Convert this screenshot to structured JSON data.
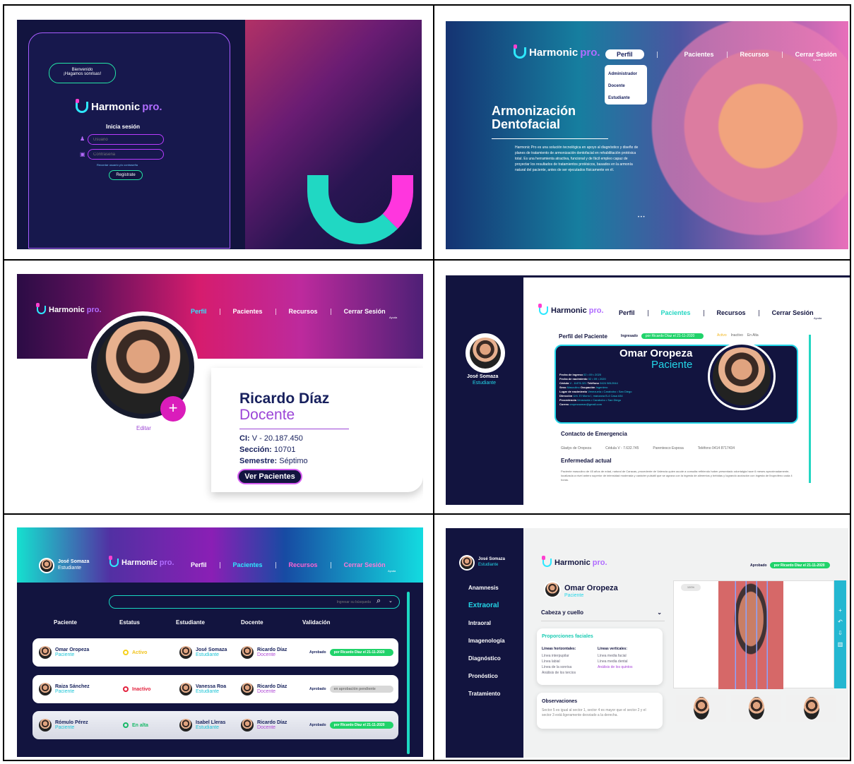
{
  "login": {
    "greeting_1": "Bienvenido",
    "greeting_2": "¡Hagamos sonrisas!",
    "brand": "Harmonic",
    "brand_pro": "pro.",
    "heading": "Inicia sesión",
    "user_placeholder": "Usuario",
    "password_placeholder": "Contraseña",
    "forgot": "Recordar usuario y/o contraseña",
    "register": "Registrate"
  },
  "home": {
    "brand": "Harmonic",
    "brand_pro": "pro.",
    "nav": [
      "Perfil",
      "Pacientes",
      "Recursos",
      "Cerrar Sesión"
    ],
    "help": "Ayuda",
    "dropdown": [
      "Administrador",
      "Docente",
      "Estudiante"
    ],
    "hero_title": "Armonización Dentofacial",
    "hero_body": "Harmonic Pro es una solución tecnológica en apoyo al diagnóstico y diseño de planes de tratamiento de armonización dentofacial en rehabilitación protésica total. Es una herramienta atractiva, funcional y de fácil empleo capaz de proyectar los resultados de tratamientos protésicos, basados en la armonía natural del paciente, antes de ser ejecutados físicamente en él.",
    "dots": "• • •"
  },
  "profile": {
    "brand": "Harmonic",
    "brand_pro": "pro.",
    "nav": [
      "Perfil",
      "Pacientes",
      "Recursos",
      "Cerrar Sesión"
    ],
    "help": "Ayuda",
    "edit": "Editar",
    "name": "Ricardo Díaz",
    "role": "Docente",
    "ci_label": "CI:",
    "ci": "V - 20.187.450",
    "section_label": "Sección:",
    "section": "10701",
    "semester_label": "Semestre:",
    "semester": "Séptimo",
    "button": "Ver Pacientes"
  },
  "patient": {
    "brand": "Harmonic",
    "brand_pro": "pro.",
    "nav": [
      "Perfil",
      "Pacientes",
      "Recursos",
      "Cerrar Sesión"
    ],
    "help": "Ayuda",
    "student_name": "José Somaza",
    "student_role": "Estudiante",
    "section_title": "Perfil del Paciente",
    "state_ingresado": "Ingresado",
    "approval_text": "por Ricardo Díaz el 21-11-2020",
    "state_active": "Activo",
    "state_inactive": "Inactivo",
    "state_discharged": "En Alta",
    "patient_name": "Omar Oropeza",
    "patient_role": "Paciente",
    "fields": [
      {
        "label": "Fecha de ingreso",
        "value": "02 • 09 • 2020"
      },
      {
        "label": "Fecha de nacimiento",
        "value": "02 • 09 • 2020"
      },
      {
        "label": "Cédula",
        "value": "V - 8.876.321"
      },
      {
        "label": "Teléfono",
        "value": "0424 9812044"
      },
      {
        "label": "Sexo",
        "value": "Masculino"
      },
      {
        "label": "Ocupación",
        "value": "Ingeniero"
      },
      {
        "label": "Lugar de nacimiento",
        "value": "Venezuela • Carabobo • San Diego"
      },
      {
        "label": "Dirección",
        "value": "Urb. El Morro I, manzana B-4 Casa #34"
      },
      {
        "label": "Procedencia",
        "value": "Venezuela • Carabobo • San Diego"
      },
      {
        "label": "Correo",
        "value": "oropezaomar@gmail.com"
      }
    ],
    "emergency_title": "Contacto de Emergencia",
    "emergency_name": "Gladys de Oropeza",
    "emergency_ci": "Cédula V - 7.632.745",
    "emergency_relation": "Parentesco Esposa",
    "emergency_phone": "Teléfono 0414 8717434",
    "illness_title": "Enfermedad actual",
    "illness_text": "Paciente masculino de 45 años de edad, natural de Caracas, procedente de Valencia quien acude a consulta refiriendo haber presentado odontalgia hace 6 meses aproximadamente, localizada a nivel antero superior de intensidad moderada y carácter pulsátil que se agrava con la ingesta de alimentos y bebidas y logrando acotación con ingesta de Ibuprofeno cada 4 horas."
  },
  "list": {
    "student_name": "José Somaza",
    "student_role": "Estudiante",
    "brand": "Harmonic",
    "brand_pro": "pro.",
    "nav": [
      "Perfil",
      "Pacientes",
      "Recursos",
      "Cerrar Sesión"
    ],
    "help": "Ayuda",
    "search_placeholder": "Ingresar su búsqueda",
    "columns": [
      "Paciente",
      "Estatus",
      "Estudiante",
      "Docente",
      "Validación"
    ],
    "rows": [
      {
        "patient": "Omar Oropeza",
        "patient_role": "Paciente",
        "status": "Activo",
        "student": "José Somaza",
        "student_role": "Estudiante",
        "teacher": "Ricardo Díaz",
        "teacher_role": "Docente",
        "validation": "Aprobado",
        "approval": "por Ricardo Díaz el 21-11-2020"
      },
      {
        "patient": "Raiza Sánchez",
        "patient_role": "Paciente",
        "status": "Inactivo",
        "student": "Vanessa Roa",
        "student_role": "Estudiante",
        "teacher": "Ricardo Díaz",
        "teacher_role": "Docente",
        "validation": "Aprobado",
        "approval": "en aprobación pendiente"
      },
      {
        "patient": "Rómulo Pérez",
        "patient_role": "Paciente",
        "status": "En alta",
        "student": "Isabel Lleras",
        "student_role": "Estudiante",
        "teacher": "Ricardo Díaz",
        "teacher_role": "Docente",
        "validation": "Aprobado",
        "approval": "por Ricardo Díaz el 21-11-2020"
      }
    ]
  },
  "analysis": {
    "student_name": "José Somaza",
    "student_role": "Estudiante",
    "brand": "Harmonic",
    "brand_pro": "pro.",
    "menu": [
      "Anamnesis",
      "Extraoral",
      "Intraoral",
      "Imagenología",
      "Diagnóstico",
      "Pronóstico",
      "Tratamiento"
    ],
    "patient_name": "Omar Oropeza",
    "patient_role": "Paciente",
    "approved": "Aprobado",
    "approval": "por Ricardo Díaz el 21-11-2020",
    "section": "Cabeza y cuello",
    "subsection": "Proporciones faciales",
    "horizontal_title": "Líneas horizontales:",
    "horizontal": [
      "Línea interpupilar",
      "Línea labial",
      "Línea de la sonrisa",
      "Análisis de los tercios"
    ],
    "vertical_title": "Líneas verticales:",
    "vertical": [
      "Línea media facial",
      "Línea media dental",
      "Análisis de los quintos"
    ],
    "observations_title": "Observaciones",
    "observations": "Sector 5 es igual al sector 1, sector 4 es mayor que el sector 2 y el sector 3 está ligeramente desviado a la derecha.",
    "zoom": "100%"
  },
  "colors": {
    "navy": "#12143f",
    "cyan": "#2ee8ff",
    "magenta": "#ff3fd0",
    "green": "#20d36a"
  }
}
